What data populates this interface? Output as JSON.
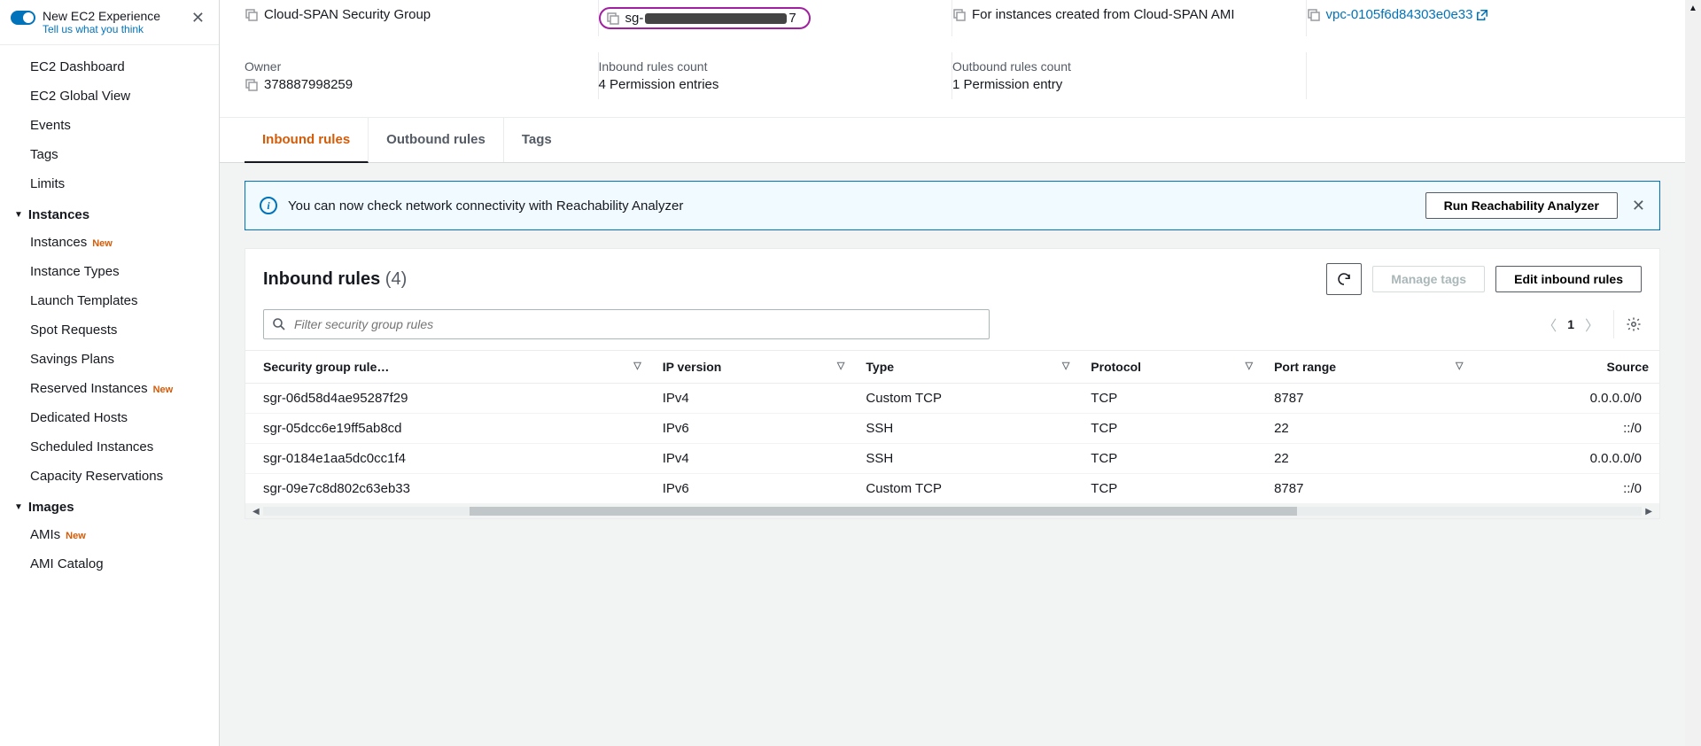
{
  "experience": {
    "title": "New EC2 Experience",
    "subtitle": "Tell us what you think"
  },
  "nav": {
    "top": [
      "EC2 Dashboard",
      "EC2 Global View",
      "Events",
      "Tags",
      "Limits"
    ],
    "instances_label": "Instances",
    "instances": [
      {
        "label": "Instances",
        "new": true
      },
      {
        "label": "Instance Types",
        "new": false
      },
      {
        "label": "Launch Templates",
        "new": false
      },
      {
        "label": "Spot Requests",
        "new": false
      },
      {
        "label": "Savings Plans",
        "new": false
      },
      {
        "label": "Reserved Instances",
        "new": true
      },
      {
        "label": "Dedicated Hosts",
        "new": false
      },
      {
        "label": "Scheduled Instances",
        "new": false
      },
      {
        "label": "Capacity Reservations",
        "new": false
      }
    ],
    "images_label": "Images",
    "images": [
      {
        "label": "AMIs",
        "new": true
      },
      {
        "label": "AMI Catalog",
        "new": false
      }
    ],
    "new_badge": "New"
  },
  "details": {
    "name": "Cloud-SPAN Security Group",
    "sg_prefix": "sg-",
    "sg_suffix": "7",
    "desc": "For instances created from Cloud-SPAN AMI",
    "vpc": "vpc-0105f6d84303e0e33",
    "owner_label": "Owner",
    "owner": "378887998259",
    "inbound_label": "Inbound rules count",
    "inbound_count": "4 Permission entries",
    "outbound_label": "Outbound rules count",
    "outbound_count": "1 Permission entry"
  },
  "tabs": {
    "inbound": "Inbound rules",
    "outbound": "Outbound rules",
    "tags": "Tags"
  },
  "banner": {
    "text": "You can now check network connectivity with Reachability Analyzer",
    "button": "Run Reachability Analyzer"
  },
  "rules": {
    "title": "Inbound rules",
    "count": "(4)",
    "manage_tags": "Manage tags",
    "edit": "Edit inbound rules",
    "search_placeholder": "Filter security group rules",
    "page": "1",
    "columns": [
      "Security group rule…",
      "IP version",
      "Type",
      "Protocol",
      "Port range",
      "Source"
    ],
    "rows": [
      {
        "id": "sgr-06d58d4ae95287f29",
        "ipv": "IPv4",
        "type": "Custom TCP",
        "proto": "TCP",
        "port": "8787",
        "src": "0.0.0.0/0"
      },
      {
        "id": "sgr-05dcc6e19ff5ab8cd",
        "ipv": "IPv6",
        "type": "SSH",
        "proto": "TCP",
        "port": "22",
        "src": "::/0"
      },
      {
        "id": "sgr-0184e1aa5dc0cc1f4",
        "ipv": "IPv4",
        "type": "SSH",
        "proto": "TCP",
        "port": "22",
        "src": "0.0.0.0/0"
      },
      {
        "id": "sgr-09e7c8d802c63eb33",
        "ipv": "IPv6",
        "type": "Custom TCP",
        "proto": "TCP",
        "port": "8787",
        "src": "::/0"
      }
    ]
  }
}
